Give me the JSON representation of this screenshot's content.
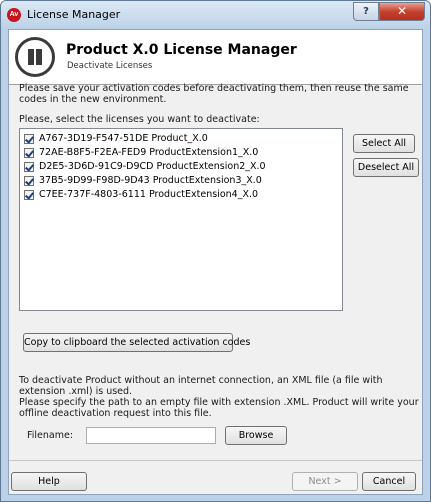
{
  "window": {
    "title": "License Manager",
    "app_icon_label": "Av",
    "help_glyph": "?",
    "close_glyph": "✕"
  },
  "header": {
    "title": "Product X.0 License Manager",
    "subtitle": "Deactivate Licenses"
  },
  "body": {
    "instructions": "Please save your activation codes before deactivating them, then reuse the same codes in the new environment.",
    "select_prompt": "Please, select the licenses you want to deactivate:",
    "licenses": [
      {
        "code": "A767-3D19-F547-51DE",
        "product": "Product_X.0",
        "checked": true
      },
      {
        "code": "72AE-B8F5-F2EA-FED9",
        "product": "ProductExtension1_X.0",
        "checked": true
      },
      {
        "code": "D2E5-3D6D-91C9-D9CD",
        "product": "ProductExtension2_X.0",
        "checked": true
      },
      {
        "code": "37B5-9D99-F98D-9D43",
        "product": "ProductExtension3_X.0",
        "checked": true
      },
      {
        "code": "C7EE-737F-4803-6111",
        "product": "ProductExtension4_X.0",
        "checked": true
      }
    ],
    "copy_button": "Copy to clipboard the selected activation codes",
    "select_all_button": "Select All",
    "deselect_all_button": "Deselect All",
    "offline_text_1": "To deactivate Product without an internet connection, an XML file (a file with extension .xml) is used.",
    "offline_text_2": "Please specify the path to an empty file with extension .XML. Product will write your offline deactivation request into this file.",
    "filename_label": "Filename:",
    "filename_value": "",
    "browse_button": "Browse"
  },
  "footer": {
    "help_button": "Help",
    "next_button": "Next >",
    "cancel_button": "Cancel"
  },
  "colors": {
    "frame": "#bcd2e8",
    "close_button": "#c5422f",
    "app_icon": "#c4161c",
    "check": "#1c3f82"
  }
}
